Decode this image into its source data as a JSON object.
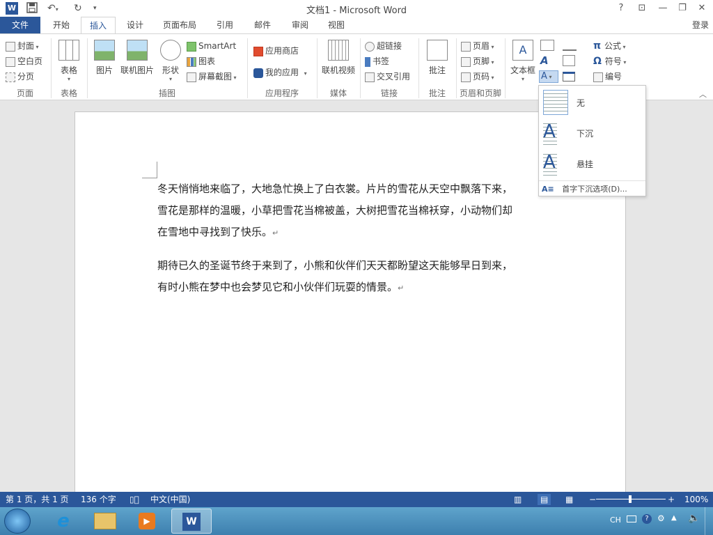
{
  "title_bar": {
    "title": "文档1 - Microsoft Word",
    "help": "?",
    "ribbon_display": "⊡",
    "minimize": "—",
    "restore": "❐",
    "close": "✕"
  },
  "tabs": [
    {
      "label": "文件"
    },
    {
      "label": "开始"
    },
    {
      "label": "插入"
    },
    {
      "label": "设计"
    },
    {
      "label": "页面布局"
    },
    {
      "label": "引用"
    },
    {
      "label": "邮件"
    },
    {
      "label": "审阅"
    },
    {
      "label": "视图"
    }
  ],
  "login": "登录",
  "ribbon": {
    "pages": {
      "cover": "封面",
      "blank": "空白页",
      "break": "分页",
      "group": "页面"
    },
    "tables": {
      "table": "表格",
      "group": "表格"
    },
    "illustrations": {
      "picture": "图片",
      "online_picture": "联机图片",
      "shapes": "形状",
      "smartart": "SmartArt",
      "chart": "图表",
      "screenshot": "屏幕截图",
      "group": "插图"
    },
    "apps": {
      "store": "应用商店",
      "my_apps": "我的应用",
      "group": "应用程序"
    },
    "media": {
      "online_video": "联机视频",
      "group": "媒体"
    },
    "links": {
      "hyperlink": "超链接",
      "bookmark": "书签",
      "crossref": "交叉引用",
      "group": "链接"
    },
    "comments": {
      "comment": "批注",
      "group": "批注"
    },
    "header_footer": {
      "header": "页眉",
      "footer": "页脚",
      "page_number": "页码",
      "group": "页眉和页脚"
    },
    "text": {
      "textbox": "文本框"
    },
    "symbols": {
      "equation": "公式",
      "symbol": "符号",
      "number": "编号"
    }
  },
  "dropcap_menu": {
    "items": [
      {
        "label": "无"
      },
      {
        "label": "下沉"
      },
      {
        "label": "悬挂"
      }
    ],
    "options": "首字下沉选项(D)..."
  },
  "document": {
    "paragraphs": [
      {
        "line1": "冬天悄悄地来临了，大地急忙换上了白衣裳。片片的雪花从天空中飘落下来，",
        "line2": "雪花是那样的温暖，小草把雪花当棉被盖，大树把雪花当棉袄穿，小动物们却",
        "line3": "在雪地中寻找到了快乐。"
      },
      {
        "line1": "期待已久的圣诞节终于来到了，小熊和伙伴们天天都盼望这天能够早日到来，",
        "line2": "有时小熊在梦中也会梦见它和小伙伴们玩耍的情景。"
      }
    ],
    "para_mark": "↵"
  },
  "status_bar": {
    "page": "第 1 页，共 1 页",
    "words": "136 个字",
    "language": "中文(中国)",
    "zoom": "100%",
    "zoom_minus": "−",
    "zoom_plus": "+"
  },
  "taskbar": {
    "ime": "CH"
  },
  "colors": {
    "accent": "#2b579a"
  }
}
